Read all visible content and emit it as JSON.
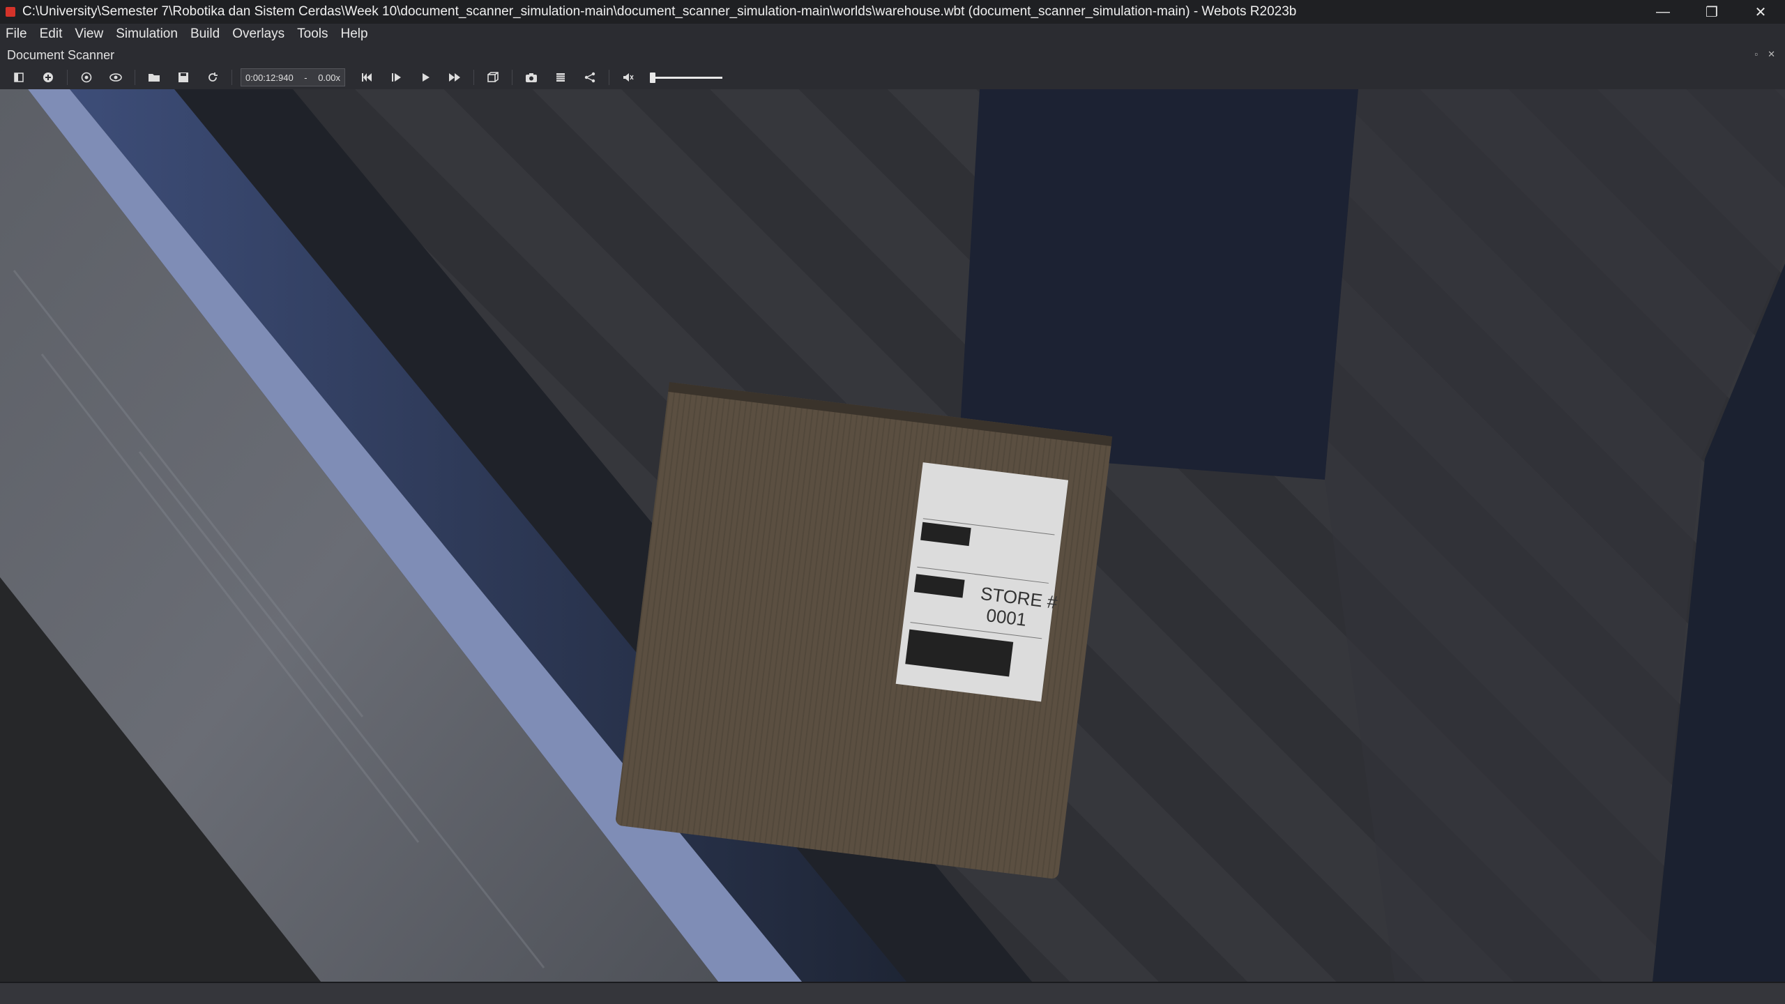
{
  "window": {
    "title": "C:\\University\\Semester 7\\Robotika dan Sistem Cerdas\\Week 10\\document_scanner_simulation-main\\document_scanner_simulation-main\\worlds\\warehouse.wbt (document_scanner_simulation-main) - Webots R2023b",
    "app_icon": "webots-icon",
    "controls": {
      "minimize": "—",
      "restore": "❐",
      "close": "✕"
    }
  },
  "menu": {
    "items": [
      "File",
      "Edit",
      "View",
      "Simulation",
      "Build",
      "Overlays",
      "Tools",
      "Help"
    ]
  },
  "dock": {
    "title": "Document Scanner",
    "float_glyph": "▫",
    "close_glyph": "✕"
  },
  "toolbar": {
    "icons": [
      "hide-scene-tree-icon",
      "add-node-icon",
      "step-icon",
      "view-icon",
      "open-world-icon",
      "save-world-icon",
      "reload-world-icon",
      "reset-icon",
      "step-forward-icon",
      "play-icon",
      "fast-forward-icon",
      "view-3d-icon",
      "screenshot-icon",
      "movie-icon",
      "share-icon",
      "sound-icon"
    ],
    "time": "0:00:12:940",
    "time_sep": "-",
    "speed": "0.00x",
    "volume": 0.0
  },
  "scene": {
    "label_store": "STORE #",
    "label_store_number": "0001",
    "colors": {
      "background": "#2f3035",
      "conveyor_blue": "#7f8db6",
      "conveyor_dark_blue": "#2b3854",
      "floor_stripe": "#35363b",
      "pillar": "#1c2233",
      "box": "#5b4f42",
      "label": "#dcdcdc"
    }
  }
}
